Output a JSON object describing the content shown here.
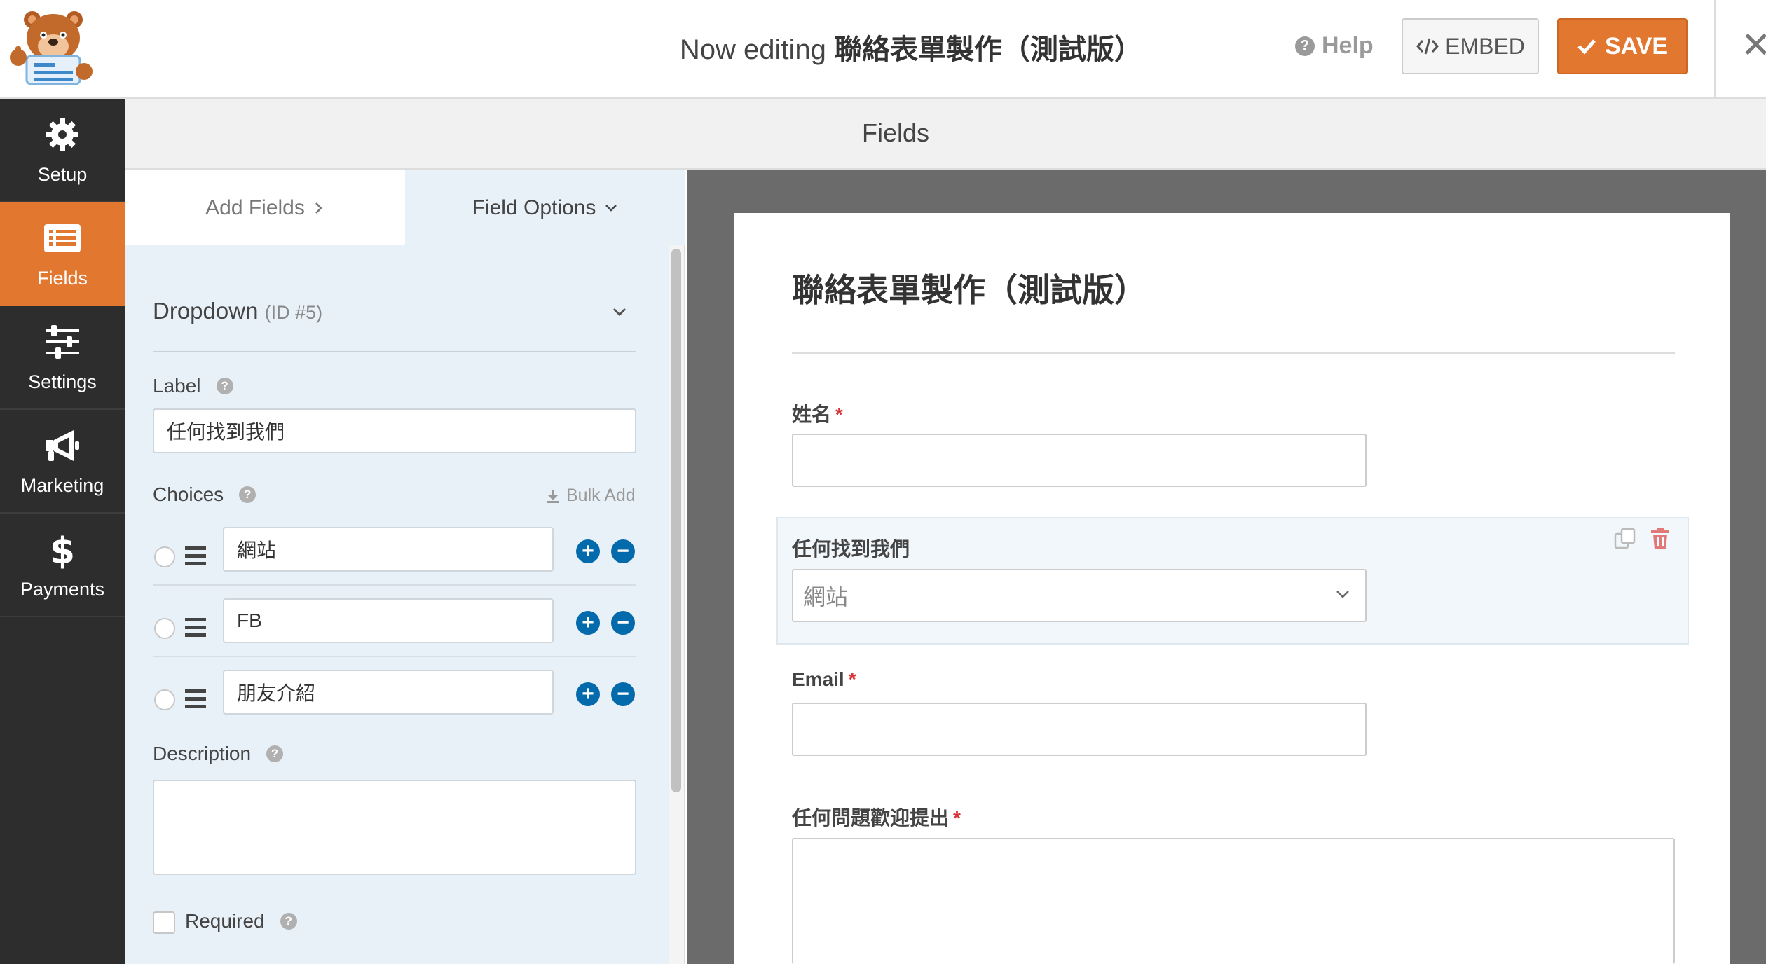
{
  "topbar": {
    "title_prefix": "Now editing",
    "form_name": "聯絡表單製作（測試版）",
    "help_label": "Help",
    "embed_label": "EMBED",
    "save_label": "SAVE"
  },
  "sidenav": {
    "items": [
      {
        "label": "Setup",
        "icon": "gear-icon"
      },
      {
        "label": "Fields",
        "icon": "list-icon",
        "active": true
      },
      {
        "label": "Settings",
        "icon": "sliders-icon"
      },
      {
        "label": "Marketing",
        "icon": "megaphone-icon"
      },
      {
        "label": "Payments",
        "icon": "dollar-icon"
      }
    ]
  },
  "header": {
    "title": "Fields"
  },
  "panel": {
    "tabs": [
      {
        "label": "Add Fields",
        "active": false
      },
      {
        "label": "Field Options",
        "active": true
      }
    ],
    "field_type": "Dropdown",
    "field_id": "(ID #5)",
    "label_title": "Label",
    "label_value": "任何找到我們",
    "choices_title": "Choices",
    "bulk_add": "Bulk Add",
    "choices": [
      "網站",
      "FB",
      "朋友介紹"
    ],
    "description_title": "Description",
    "description_value": "",
    "required_label": "Required",
    "required_checked": false
  },
  "preview": {
    "form_title": "聯絡表單製作（測試版）",
    "fields": [
      {
        "label": "姓名",
        "required": true,
        "type": "text"
      },
      {
        "label": "任何找到我們",
        "required": false,
        "type": "select",
        "value": "網站"
      },
      {
        "label": "Email",
        "required": true,
        "type": "text"
      },
      {
        "label": "任何問題歡迎提出",
        "required": true,
        "type": "textarea"
      }
    ],
    "required_marker": "*"
  },
  "colors": {
    "accent": "#e27730",
    "nav_bg": "#2d2d2d",
    "panel_bg": "#e9f1f8",
    "choice_buttons": "#036aab",
    "required": "#d63638",
    "preview_bg": "#6b6b6b"
  }
}
